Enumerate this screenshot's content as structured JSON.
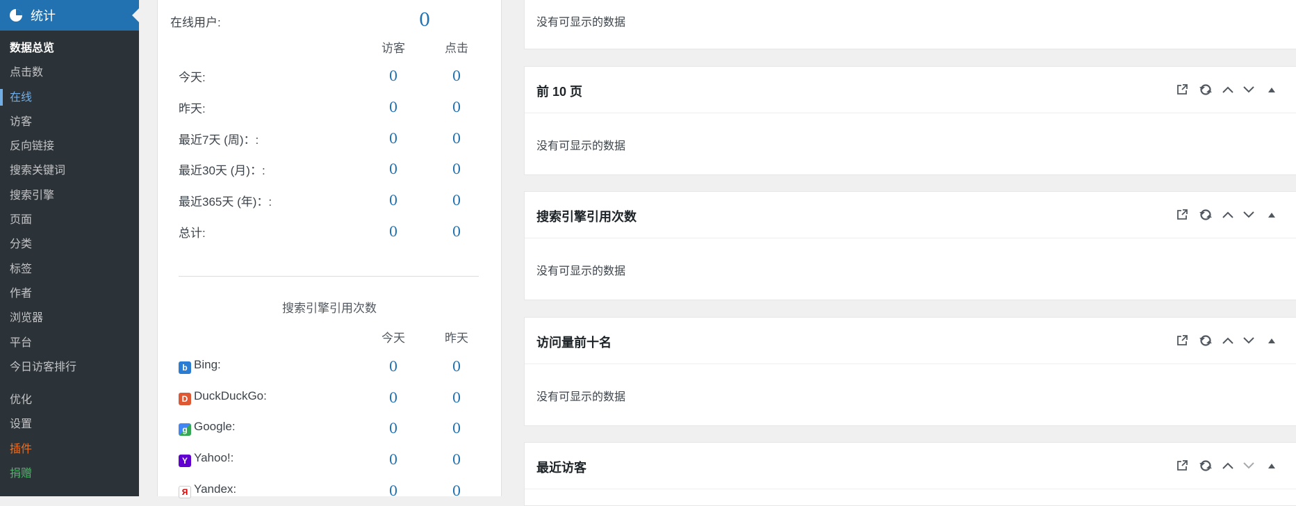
{
  "sidebar": {
    "menu_title": "统计",
    "items": [
      {
        "label": "数据总览"
      },
      {
        "label": "点击数"
      },
      {
        "label": "在线"
      },
      {
        "label": "访客"
      },
      {
        "label": "反向链接"
      },
      {
        "label": "搜索关键词"
      },
      {
        "label": "搜索引擎"
      },
      {
        "label": "页面"
      },
      {
        "label": "分类"
      },
      {
        "label": "标签"
      },
      {
        "label": "作者"
      },
      {
        "label": "浏览器"
      },
      {
        "label": "平台"
      },
      {
        "label": "今日访客排行"
      },
      {
        "label": "优化"
      },
      {
        "label": "设置"
      },
      {
        "label": "插件"
      },
      {
        "label": "捐赠"
      }
    ]
  },
  "summary": {
    "online_label": "在线用户:",
    "online_value": "0",
    "col_visitors": "访客",
    "col_visits": "点击",
    "rows": [
      {
        "label": "今天:",
        "visitors": "0",
        "visits": "0"
      },
      {
        "label": "昨天:",
        "visitors": "0",
        "visits": "0"
      },
      {
        "label": "最近7天 (周)：:",
        "visitors": "0",
        "visits": "0"
      },
      {
        "label": "最近30天 (月)：:",
        "visitors": "0",
        "visits": "0"
      },
      {
        "label": "最近365天 (年)：:",
        "visitors": "0",
        "visits": "0"
      },
      {
        "label": "总计:",
        "visitors": "0",
        "visits": "0"
      }
    ],
    "search_title": "搜索引擎引用次数",
    "col_today": "今天",
    "col_yesterday": "昨天",
    "engines": [
      {
        "name": "Bing:",
        "icon": "bing-icon",
        "today": "0",
        "yesterday": "0"
      },
      {
        "name": "DuckDuckGo:",
        "icon": "duckduckgo-icon",
        "today": "0",
        "yesterday": "0"
      },
      {
        "name": "Google:",
        "icon": "google-icon",
        "today": "0",
        "yesterday": "0"
      },
      {
        "name": "Yahoo!:",
        "icon": "yahoo-icon",
        "today": "0",
        "yesterday": "0"
      },
      {
        "name": "Yandex:",
        "icon": "yandex-icon",
        "today": "0",
        "yesterday": "0"
      }
    ]
  },
  "boxes": {
    "empty_text": "没有可显示的数据",
    "top_pages_title": "前 10 页",
    "search_title": "搜索引擎引用次数",
    "top_visitors_title": "访问量前十名",
    "recent_title": "最近访客"
  },
  "colors": {
    "accent": "#2271b1",
    "sidebar_bg": "#2c3338",
    "plugins": "#f06e1e",
    "donate": "#4ab866"
  }
}
